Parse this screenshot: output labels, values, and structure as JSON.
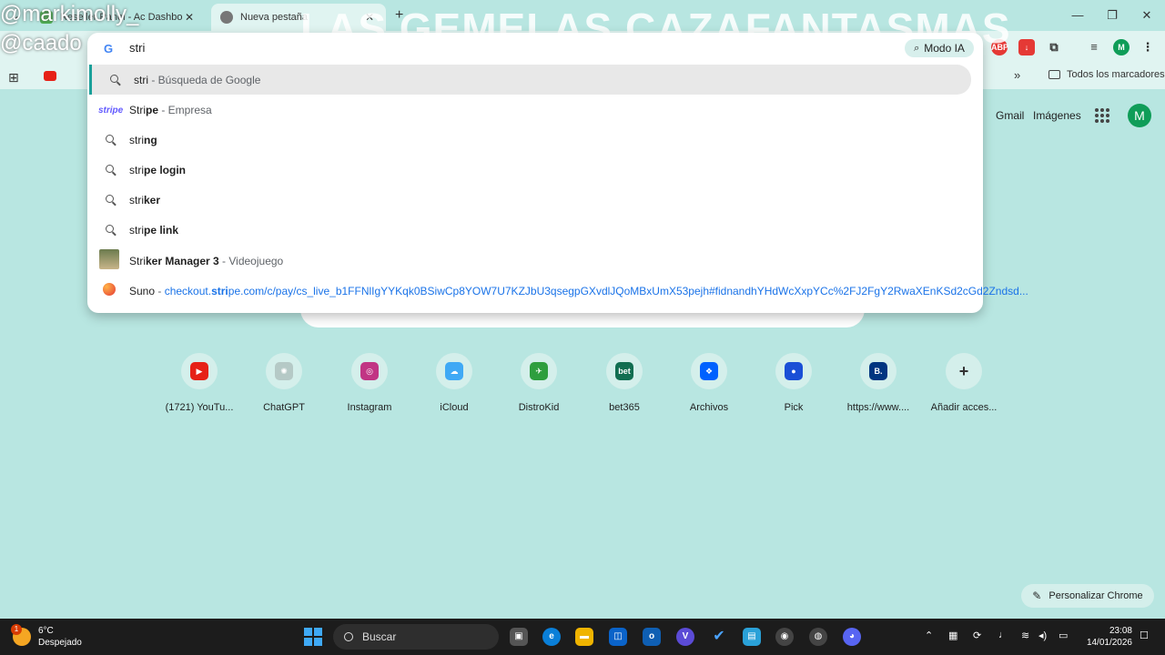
{
  "tabs": [
    {
      "label": "Reseller Panel - Ac Dashboard"
    },
    {
      "label": "Nueva pestaña"
    }
  ],
  "overlay": {
    "user_line1": "@markimolly_",
    "user_line2": "@caado",
    "title": "LAS GEMELAS CAZAFANTASMAS"
  },
  "omnibox": {
    "value": "stri",
    "mode_ia": "Modo IA",
    "suggestions": [
      {
        "prefix": "stri",
        "rest": "",
        "sub": " - Búsqueda de Google"
      },
      {
        "prefix": "Stri",
        "rest": "pe",
        "sub": " - Empresa"
      },
      {
        "prefix": "stri",
        "rest": "ng",
        "sub": ""
      },
      {
        "prefix": "stri",
        "rest": "pe login",
        "sub": ""
      },
      {
        "prefix": "stri",
        "rest": "ker",
        "sub": ""
      },
      {
        "prefix": "stri",
        "rest": "pe link",
        "sub": ""
      },
      {
        "prefix": "Stri",
        "rest": "ker Manager 3",
        "sub": " - Videojuego"
      },
      {
        "title": "Suno",
        "sep": " - ",
        "url_pre": "checkout.",
        "url_match": "stri",
        "url_post": "pe.com/c/pay/cs_live_b1FFNlIgYYKqk0BSiwCp8YOW7U7KZJbU3qsegpGXvdlJQoMBxUmX53pejh#fidnandhYHdWcXxpYCc%2FJ2FgY2RwaXEnKSd2cGd2Zndsd..."
      }
    ],
    "stripe_logo": "stripe"
  },
  "bookmarks": {
    "all_label": "Todos los marcadores"
  },
  "google": {
    "gmail": "Gmail",
    "images": "Imágenes",
    "avatar": "M"
  },
  "shortcuts": [
    {
      "name": "(1721) YouTu...",
      "icon": "youtube-icon",
      "color": "#e62117",
      "glyph": "▶"
    },
    {
      "name": "ChatGPT",
      "icon": "chatgpt-icon",
      "color": "#b5c9c6",
      "glyph": "✺"
    },
    {
      "name": "Instagram",
      "icon": "instagram-icon",
      "color": "#c13584",
      "glyph": "◎"
    },
    {
      "name": "iCloud",
      "icon": "icloud-icon",
      "color": "#3fa9f5",
      "glyph": "☁"
    },
    {
      "name": "DistroKid",
      "icon": "distrokid-icon",
      "color": "#2e9e3e",
      "glyph": "✈"
    },
    {
      "name": "bet365",
      "icon": "bet365-icon",
      "color": "#126e51",
      "glyph": "bet"
    },
    {
      "name": "Archivos",
      "icon": "dropbox-icon",
      "color": "#0061fe",
      "glyph": "❖"
    },
    {
      "name": "Pick",
      "icon": "pick-icon",
      "color": "#1a4fd6",
      "glyph": "●"
    },
    {
      "name": "https://www....",
      "icon": "booking-icon",
      "color": "#003580",
      "glyph": "B."
    },
    {
      "name": "Añadir acces...",
      "icon": "add-icon",
      "color": "#d4efeb",
      "glyph": "+"
    }
  ],
  "customize_label": "Personalizar Chrome",
  "taskbar": {
    "temp": "6°C",
    "weather": "Despejado",
    "weather_badge": "1",
    "search_label": "Buscar",
    "time": "23:08",
    "date": "14/01/2026"
  }
}
